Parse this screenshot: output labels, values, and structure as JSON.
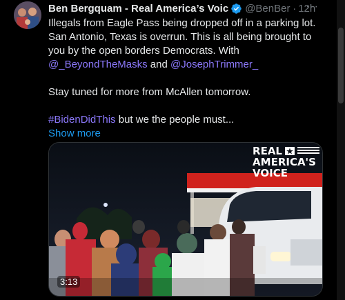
{
  "tweet": {
    "author_name": "Ben Bergquam - Real America’s Voic",
    "handle": "@BenBerg",
    "time": "12h",
    "more_icon": "···",
    "text_line1": "Illegals from Eagle Pass being dropped off in a parking lot. San Antonio, Texas is overrun. This is all being brought to you by the open borders Democrats. With ",
    "mention1": "@_BeyondTheMasks",
    "and_word": " and ",
    "mention2": "@JosephTrimmer_",
    "text_line2": "Stay tuned for more from McAllen tomorrow.",
    "hashtag": "#BidenDidThis",
    "text_line3": " but we the people must...",
    "show_more": "Show more"
  },
  "media": {
    "logo_line1": "REAL",
    "logo_line2": "AMERICA'S",
    "logo_line3": "VOICE",
    "duration": "3:13"
  },
  "colors": {
    "link": "#8b78fa",
    "show_more": "#1d9bf0",
    "verified": "#1d9bf0",
    "muted": "#71767b"
  }
}
